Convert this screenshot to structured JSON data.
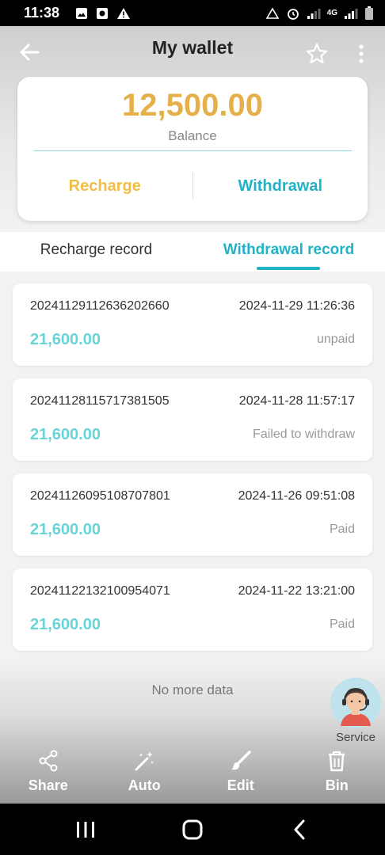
{
  "status_bar": {
    "time": "11:38",
    "network": "4G"
  },
  "header": {
    "title": "My wallet"
  },
  "balance": {
    "amount": "12,500.00",
    "label": "Balance",
    "recharge_label": "Recharge",
    "withdrawal_label": "Withdrawal"
  },
  "colors": {
    "accent_teal": "#1fb3c5",
    "accent_gold": "#e5b04a",
    "amount_teal": "#6ad3d8"
  },
  "tabs": [
    {
      "label": "Recharge record",
      "active": false
    },
    {
      "label": "Withdrawal record",
      "active": true
    }
  ],
  "records": [
    {
      "id": "20241129112636202660",
      "time": "2024-11-29 11:26:36",
      "amount": "21,600.00",
      "status": "unpaid"
    },
    {
      "id": "20241128115717381505",
      "time": "2024-11-28 11:57:17",
      "amount": "21,600.00",
      "status": "Failed to withdraw"
    },
    {
      "id": "20241126095108707801",
      "time": "2024-11-26 09:51:08",
      "amount": "21,600.00",
      "status": "Paid"
    },
    {
      "id": "20241122132100954071",
      "time": "2024-11-22 13:21:00",
      "amount": "21,600.00",
      "status": "Paid"
    }
  ],
  "footer": {
    "no_more": "No more data"
  },
  "service": {
    "label": "Service"
  },
  "toolbar": [
    {
      "label": "Share",
      "icon": "share-icon"
    },
    {
      "label": "Auto",
      "icon": "magic-wand-icon"
    },
    {
      "label": "Edit",
      "icon": "brush-icon"
    },
    {
      "label": "Bin",
      "icon": "trash-icon"
    }
  ]
}
